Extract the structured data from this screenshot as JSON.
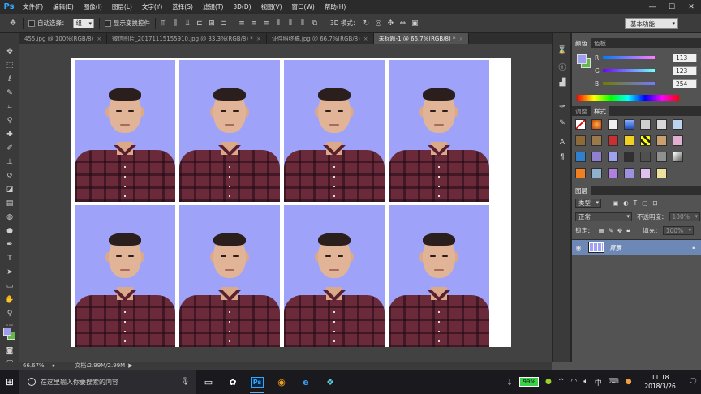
{
  "app": {
    "logo": "Ps"
  },
  "menu": [
    "文件(F)",
    "编辑(E)",
    "图像(I)",
    "图层(L)",
    "文字(Y)",
    "选择(S)",
    "滤镜(T)",
    "3D(D)",
    "视图(V)",
    "窗口(W)",
    "帮助(H)"
  ],
  "window_controls": {
    "minimize": "—",
    "maximize": "☐",
    "close": "✕"
  },
  "options": {
    "auto_select_label": "自动选择：",
    "auto_select_value": "组",
    "show_transform_label": "显示变换控件",
    "mode_3d_label": "3D 模式：",
    "workspace": "基本功能"
  },
  "tabs": [
    {
      "label": "455.jpg @ 100%(RGB/8)",
      "close": "×"
    },
    {
      "label": "微信图片_20171115155910.jpg @ 33.3%(RGB/8) *",
      "close": "×"
    },
    {
      "label": "证件照终稿.jpg @ 66.7%(RGB/8)",
      "close": "×"
    },
    {
      "label": "未标题-1 @ 66.7%(RGB/8) *",
      "close": "×"
    }
  ],
  "colors": {
    "fg": "#9e9ef0",
    "bg": "#63b847",
    "photo_bg": "#9ea2f8",
    "shirt": "#6b2a3a",
    "layer_selected": "#6e88b6"
  },
  "color_panel": {
    "tabs": [
      "颜色",
      "色板"
    ],
    "r_label": "R",
    "r_value": "113",
    "g_label": "G",
    "g_value": "123",
    "b_label": "B",
    "b_value": "254"
  },
  "styles_panel": {
    "tabs": [
      "调整",
      "样式"
    ]
  },
  "layers_panel": {
    "title": "图层",
    "kind": "类型",
    "blend": "正常",
    "opacity_label": "不透明度：",
    "opacity_value": "100%",
    "lock_label": "锁定：",
    "fill_label": "填充：",
    "fill_value": "100%",
    "layer_name": "背景"
  },
  "status": {
    "zoom": "66.67%",
    "doc": "文档:2.99M/2.99M"
  },
  "taskbar": {
    "search_placeholder": "在这里输入你要搜索的内容",
    "battery": "99%",
    "ime": "中",
    "time": "11:18",
    "date": "2018/3/26"
  }
}
